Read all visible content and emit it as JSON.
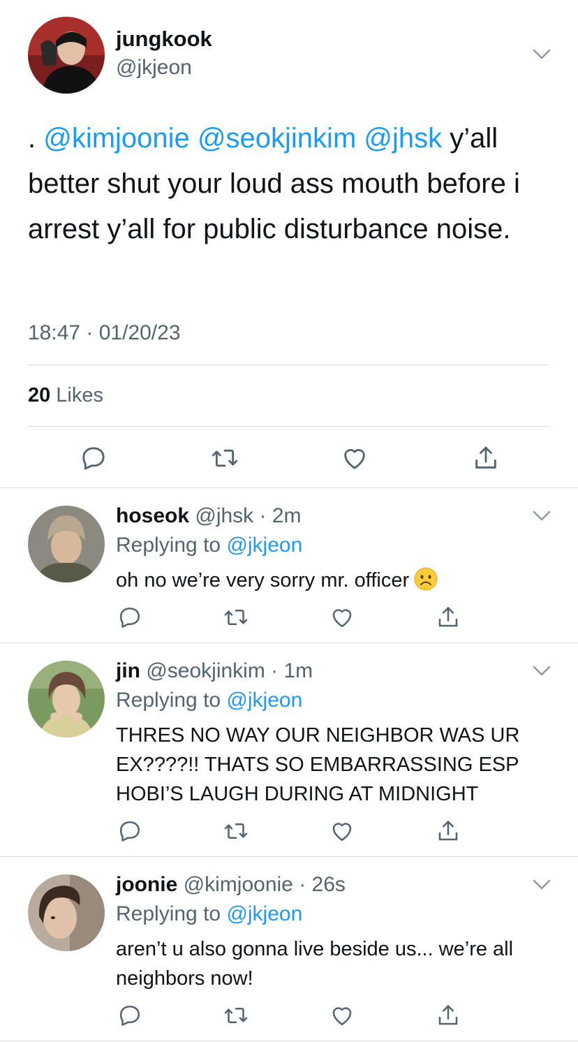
{
  "main_tweet": {
    "name": "jungkook",
    "handle": "@jkjeon",
    "text_prefix": ". ",
    "mentions": [
      "@kimjoonie",
      "@seokjinkim",
      "@jhsk"
    ],
    "text_body": " y’all better shut your loud ass mouth before i arrest y’all for public disturbance noise.",
    "timestamp": "18:47 · 01/20/23",
    "likes_count": "20",
    "likes_label": "Likes"
  },
  "replies": [
    {
      "name": "hoseok",
      "meta": "@jhsk · 2m",
      "replying_label": "Replying to",
      "replying_handle": "@jkjeon",
      "text": "oh no we’re very sorry mr. officer",
      "emoji": "frowning-face-icon"
    },
    {
      "name": "jin",
      "meta": "@seokjinkim · 1m",
      "replying_label": "Replying to",
      "replying_handle": "@jkjeon",
      "text": "THRES NO WAY OUR NEIGHBOR WAS UR EX????!! THATS SO EMBARRASSING ESP HOBI’S LAUGH DURING AT MIDNIGHT"
    },
    {
      "name": "joonie",
      "meta": "@kimjoonie · 26s",
      "replying_label": "Replying to",
      "replying_handle": "@jkjeon",
      "text": "aren’t u also gonna live beside us... we’re all neighbors now!"
    }
  ],
  "icons": {
    "caret": "chevron-down-icon",
    "reply": "reply-icon",
    "retweet": "retweet-icon",
    "like": "heart-icon",
    "share": "share-icon"
  },
  "colors": {
    "link": "#1d9bf0",
    "secondary_text": "#536471",
    "primary_text": "#0f1419",
    "divider": "#d9dde1"
  }
}
